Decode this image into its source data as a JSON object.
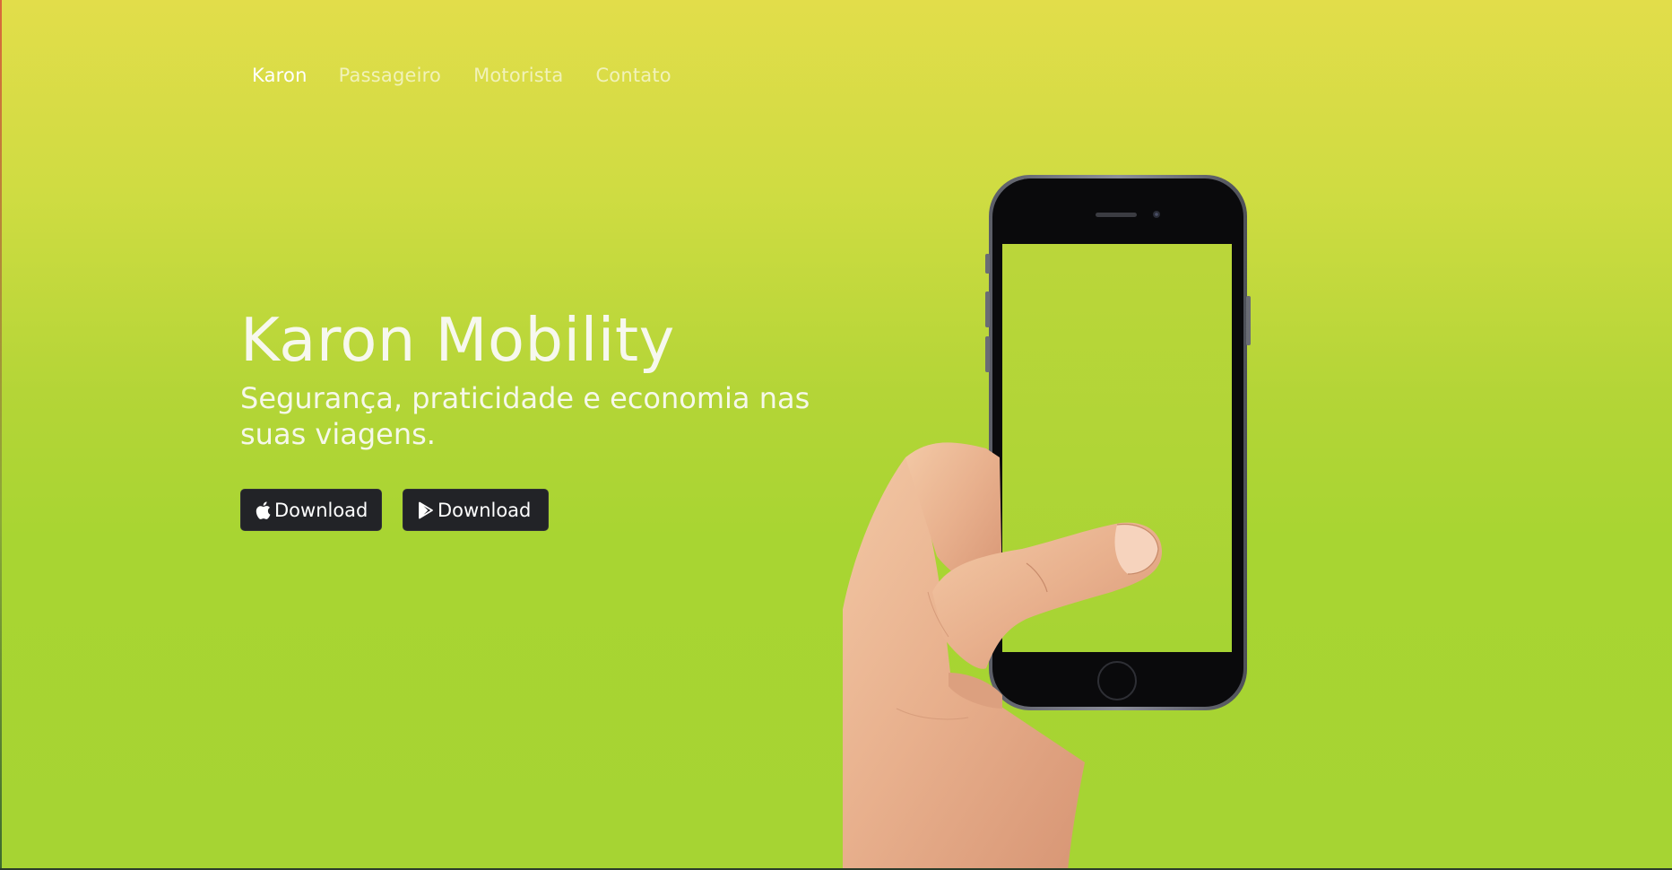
{
  "nav": {
    "brand": "Karon",
    "items": [
      "Passageiro",
      "Motorista",
      "Contato"
    ]
  },
  "hero": {
    "title": "Karon Mobility",
    "subtitle": "Segurança, praticidade e economia nas suas viagens."
  },
  "buttons": {
    "apple": {
      "label": "Download",
      "icon": "apple-icon"
    },
    "play": {
      "label": "Download",
      "icon": "google-play-icon"
    }
  },
  "colors": {
    "gradient_top": "#e2dd4a",
    "gradient_bottom": "#a6d433",
    "button_bg": "#222327",
    "text": "#ffffff"
  }
}
